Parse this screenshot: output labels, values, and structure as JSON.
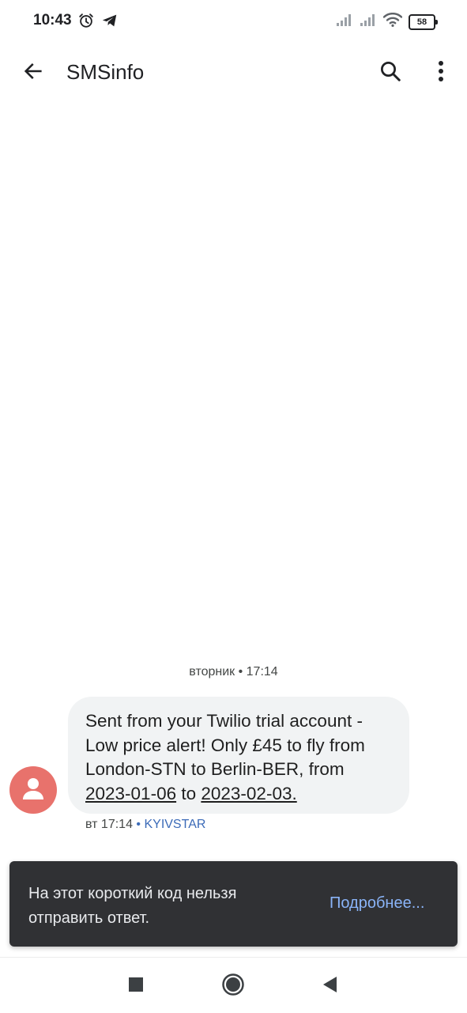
{
  "status_bar": {
    "time": "10:43",
    "battery": "58",
    "left_icons": [
      "alarm-icon",
      "telegram-icon"
    ],
    "right_icons": [
      "signal-icon",
      "signal-icon",
      "wifi-icon",
      "battery-icon"
    ]
  },
  "app_bar": {
    "title": "SMSinfo",
    "icons": [
      "back-arrow-icon",
      "search-icon",
      "more-vert-icon"
    ]
  },
  "conversation": {
    "date_separator": "вторник • 17:14",
    "message": {
      "text_before": "Sent from your Twilio trial account - Low price alert! Only £45 to fly from London-STN to Berlin-BER, from ",
      "date_from": "2023-01-06",
      "text_middle": " to ",
      "date_to": "2023-02-03.",
      "timestamp": "вт 17:14",
      "separator": " • ",
      "carrier": "KYIVSTAR"
    },
    "avatar_icon": "person-icon"
  },
  "snackbar": {
    "text": "На этот короткий код нельзя отправить ответ.",
    "action": "Подробнее..."
  },
  "nav_bar": {
    "icons": [
      "recents-square-icon",
      "home-circle-icon",
      "back-triangle-icon"
    ]
  },
  "colors": {
    "accent": "#8ab4f8",
    "avatar": "#e8726c",
    "bubble": "#f1f3f4",
    "snackbar": "#303134",
    "carrier_link": "#3c6bb8"
  }
}
